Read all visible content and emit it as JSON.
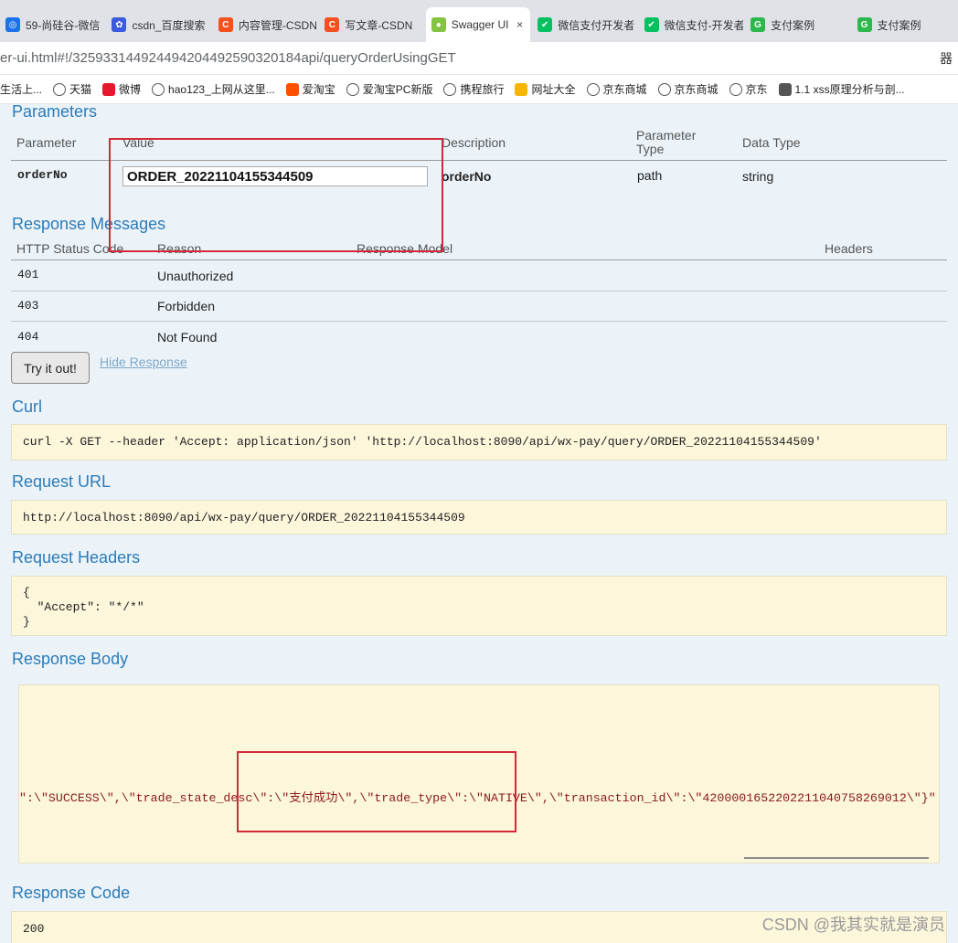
{
  "browser": {
    "tabs": [
      {
        "title": "59-尚硅谷-微信",
        "color": "#1a73e8",
        "glyph": "◎",
        "icon": "csdn-app-icon"
      },
      {
        "title": "csdn_百度搜索",
        "color": "#3b5bdb",
        "glyph": "✿",
        "icon": "baidu-paw-icon"
      },
      {
        "title": "内容管理-CSDN",
        "color": "#f4511e",
        "glyph": "C",
        "icon": "csdn-c-icon"
      },
      {
        "title": "写文章-CSDN",
        "color": "#f4511e",
        "glyph": "C",
        "icon": "csdn-c-icon"
      },
      {
        "title": "Swagger UI",
        "color": "#85c440",
        "glyph": "●",
        "icon": "swagger-icon",
        "active": true
      },
      {
        "title": "微信支付开发者",
        "color": "#07c160",
        "glyph": "✔",
        "icon": "wechat-pay-icon"
      },
      {
        "title": "微信支付-开发者",
        "color": "#07c160",
        "glyph": "✔",
        "icon": "wechat-pay-icon"
      },
      {
        "title": "支付案例",
        "color": "#2db84d",
        "glyph": "G",
        "icon": "green-g-icon"
      },
      {
        "title": "支付案例",
        "color": "#2db84d",
        "glyph": "G",
        "icon": "green-g-icon"
      }
    ],
    "close_glyph": "×",
    "url": "er-ui.html#!/325933144924494204492590320184api/queryOrderUsingGET",
    "url_end": "器",
    "bookmarks": [
      {
        "label": "生活上...",
        "colored": false
      },
      {
        "label": "天猫",
        "colored": false
      },
      {
        "label": "微博",
        "colored": true,
        "color": "#e6162d"
      },
      {
        "label": "hao123_上网从这里...",
        "colored": false
      },
      {
        "label": "爱淘宝",
        "colored": true,
        "color": "#ff5000"
      },
      {
        "label": "爱淘宝PC新版",
        "colored": false
      },
      {
        "label": "携程旅行",
        "colored": false
      },
      {
        "label": "网址大全",
        "colored": true,
        "color": "#f7b500"
      },
      {
        "label": "京东商城",
        "colored": false
      },
      {
        "label": "京东商城",
        "colored": false
      },
      {
        "label": "京东",
        "colored": false
      },
      {
        "label": "1.1 xss原理分析与剖...",
        "colored": true,
        "color": "#555555"
      }
    ]
  },
  "params": {
    "heading": "Parameters",
    "headers": {
      "parameter": "Parameter",
      "value": "Value",
      "description": "Description",
      "param_type": "Parameter Type",
      "data_type": "Data Type"
    },
    "row": {
      "name": "orderNo",
      "value": "ORDER_20221104155344509",
      "description": "orderNo",
      "param_type": "path",
      "data_type": "string"
    }
  },
  "responses": {
    "heading": "Response Messages",
    "headers": {
      "status": "HTTP Status Code",
      "reason": "Reason",
      "model": "Response Model",
      "headers": "Headers"
    },
    "rows": [
      {
        "code": "401",
        "reason": "Unauthorized"
      },
      {
        "code": "403",
        "reason": "Forbidden"
      },
      {
        "code": "404",
        "reason": "Not Found"
      }
    ]
  },
  "actions": {
    "try_label": "Try it out!",
    "hide_label": "Hide Response"
  },
  "curl": {
    "heading": "Curl",
    "text": "curl -X GET --header 'Accept: application/json' 'http://localhost:8090/api/wx-pay/query/ORDER_20221104155344509'"
  },
  "request_url": {
    "heading": "Request URL",
    "text": "http://localhost:8090/api/wx-pay/query/ORDER_20221104155344509"
  },
  "request_headers": {
    "heading": "Request Headers",
    "lines": [
      "{",
      "  \"Accept\": \"*/*\"",
      "}"
    ]
  },
  "response_body": {
    "heading": "Response Body",
    "text": "\":\\\"SUCCESS\\\",\\\"trade_state_desc\\\":\\\"支付成功\\\",\\\"trade_type\\\":\\\"NATIVE\\\",\\\"transaction_id\\\":\\\"4200001652202211040758269012\\\"}\""
  },
  "response_code": {
    "heading": "Response Code",
    "text": "200"
  },
  "watermark": "CSDN @我其实就是演员",
  "colors": {
    "heading_blue": "#2b7bb9",
    "highlight_red": "#d3283a",
    "box_bg": "#fcf6db",
    "body_text_red": "#8b1a1a"
  }
}
